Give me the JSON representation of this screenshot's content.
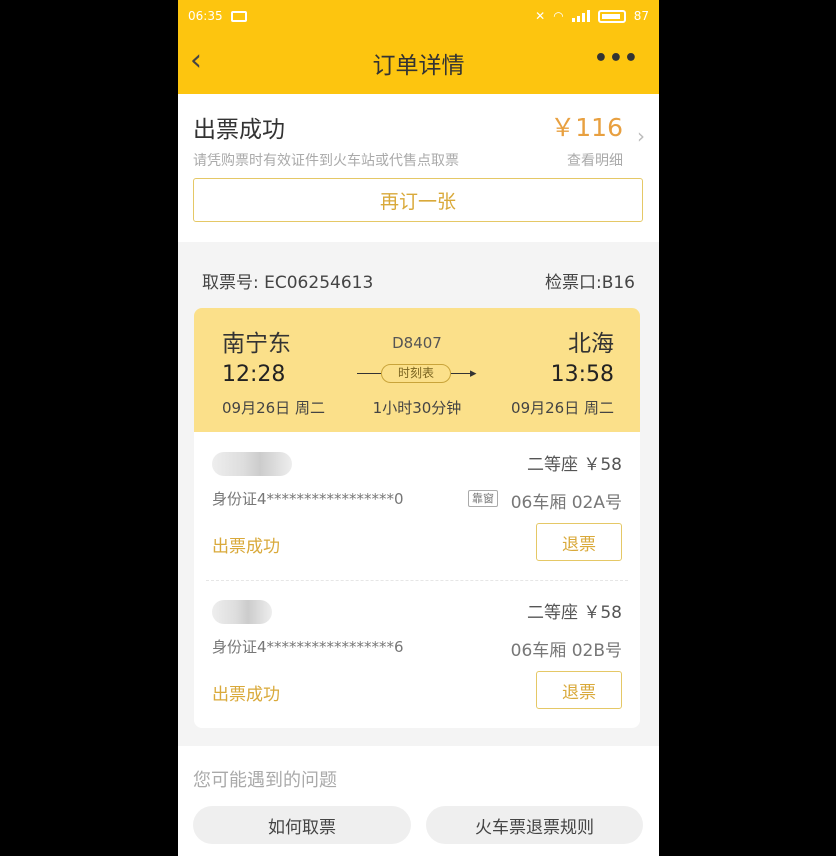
{
  "status_bar": {
    "time": "06:35",
    "battery": "87"
  },
  "header": {
    "title": "订单详情",
    "back_icon": "‹",
    "more_icon": "•••"
  },
  "order": {
    "status": "出票成功",
    "hint": "请凭购票时有效证件到火车站或代售点取票",
    "price": "￥116",
    "detail_link": "查看明细",
    "rebook_button": "再订一张"
  },
  "pickup": {
    "ticket_no": "取票号: EC06254613",
    "gate": "检票口:B16"
  },
  "train": {
    "from_station": "南宁东",
    "to_station": "北海",
    "train_no": "D8407",
    "depart_time": "12:28",
    "arrive_time": "13:58",
    "timetable_button": "时刻表",
    "depart_date": "09月26日 周二",
    "duration": "1小时30分钟",
    "arrive_date": "09月26日 周二"
  },
  "passengers": [
    {
      "seat_class": "二等座 ￥58",
      "id_card": "身份证4*****************0",
      "window_tag": "靠窗",
      "seat": "06车厢 02A号",
      "status": "出票成功",
      "refund_button": "退票"
    },
    {
      "seat_class": "二等座 ￥58",
      "id_card": "身份证4*****************6",
      "window_tag": "",
      "seat": "06车厢 02B号",
      "status": "出票成功",
      "refund_button": "退票"
    }
  ],
  "faq": {
    "title": "您可能遇到的问题",
    "items": [
      "如何取票",
      "火车票退票规则"
    ]
  },
  "colors": {
    "brand_yellow": "#fdc50f",
    "card_yellow": "#fbe08a",
    "accent_orange": "#d9a93a"
  }
}
